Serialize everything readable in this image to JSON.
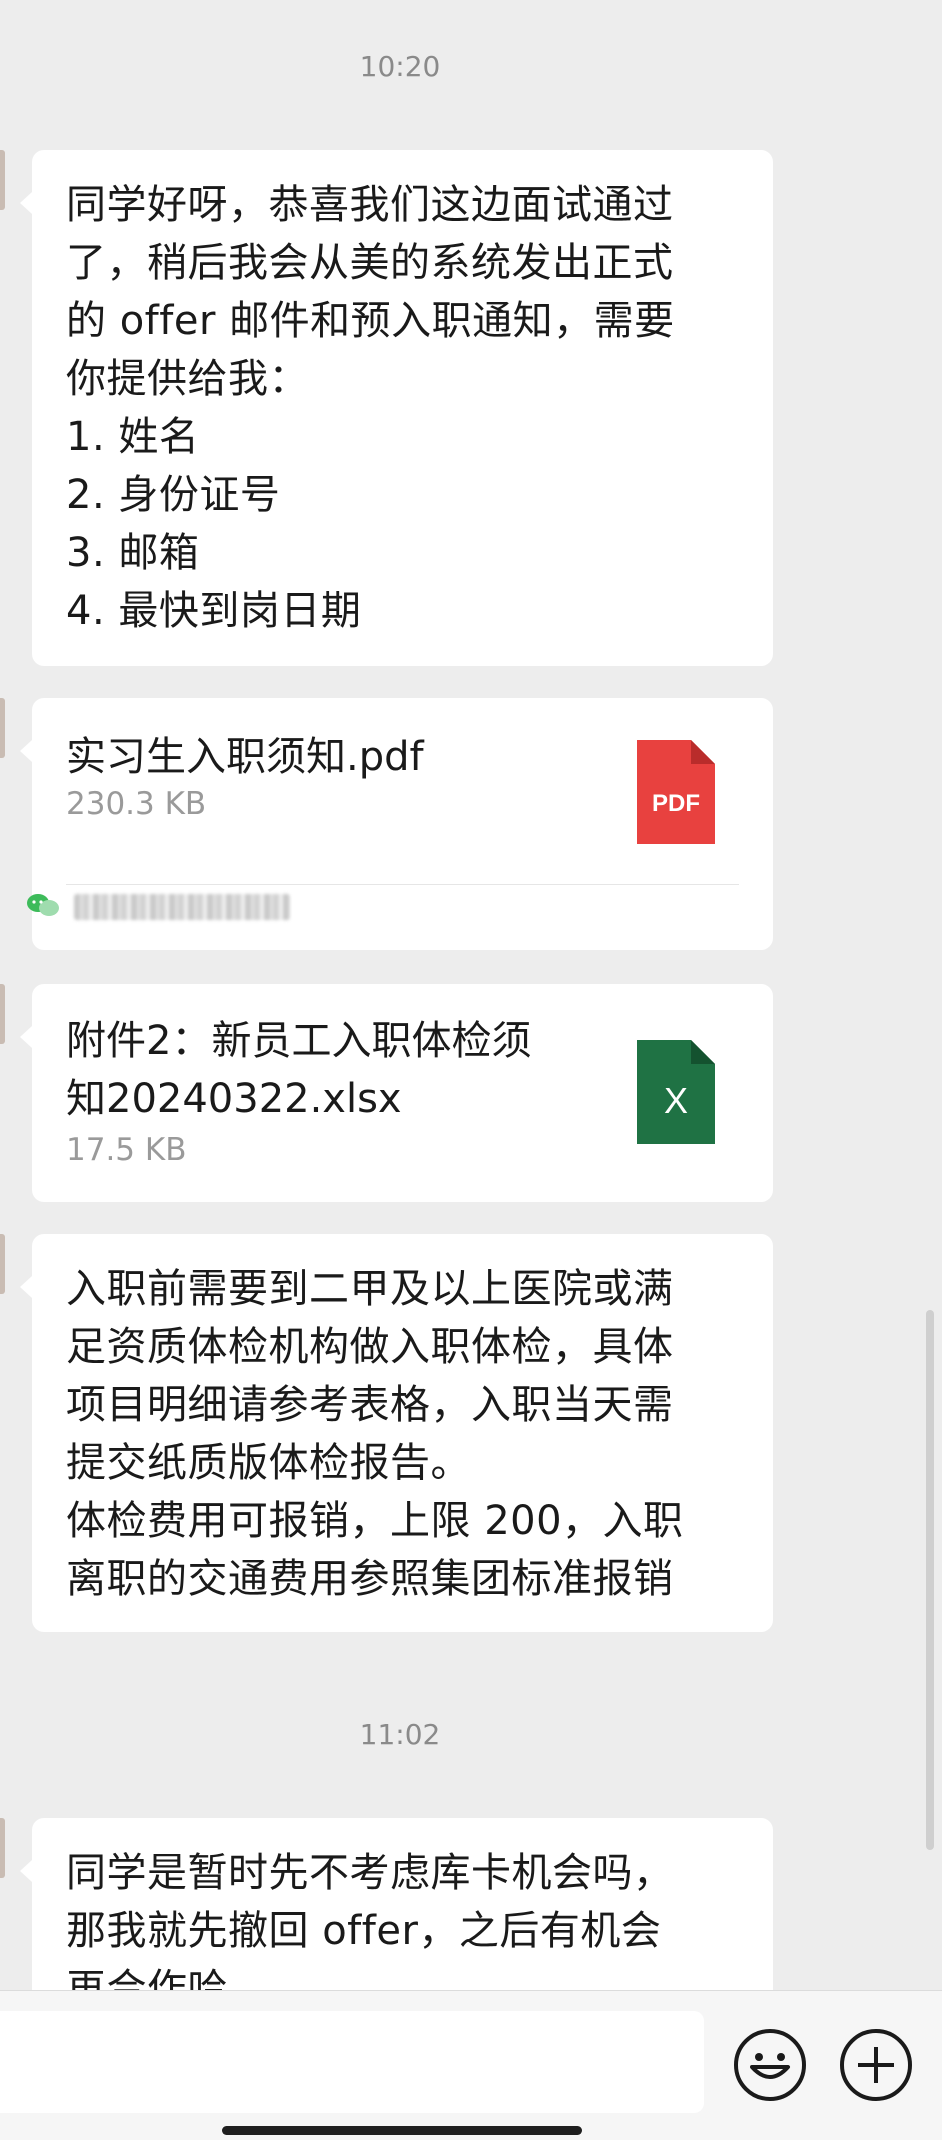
{
  "timestamps": [
    "10:20",
    "11:02"
  ],
  "messages": {
    "offer_notice": "同学好呀，恭喜我们这边面试通过\n了，稍后我会从美的系统发出正式\n的 offer 邮件和预入职通知，需要\n你提供给我：\n1. 姓名\n2. 身份证号\n3. 邮箱\n4. 最快到岗日期",
    "medical_exam": "入职前需要到二甲及以上医院或满\n足资质体检机构做入职体检，具体\n项目明细请参考表格，入职当天需\n提交纸质版体检报告。\n体检费用可报销，上限 200，入职\n离职的交通费用参照集团标准报销",
    "withdraw_partial": "同学是暂时先不考虑库卡机会吗，\n那我就先撤回 offer，之后有机会\n再合作哈"
  },
  "files": [
    {
      "name": "实习生入职须知.pdf",
      "size": "230.3 KB",
      "icon": "pdf-file-icon",
      "icon_label": "PDF",
      "color": "#e8413f"
    },
    {
      "name": "附件2：新员工入职体检须\n知20240322.xlsx",
      "size": "17.5 KB",
      "icon": "excel-file-icon",
      "icon_label": "X",
      "color": "#1f7244"
    }
  ],
  "input_bar": {
    "emoji_icon": "emoji-icon",
    "add_icon": "add-icon"
  }
}
